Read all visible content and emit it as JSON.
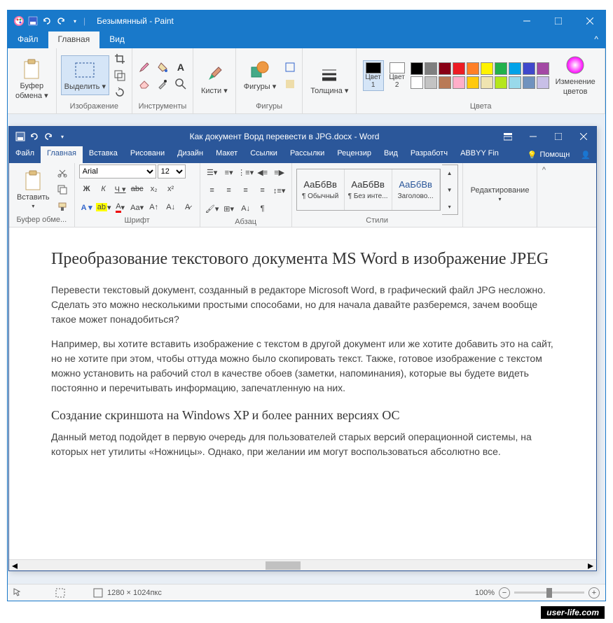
{
  "paint": {
    "title": "Безымянный - Paint",
    "tabs": {
      "file": "Файл",
      "home": "Главная",
      "view": "Вид"
    },
    "groups": {
      "clipboard": {
        "label": "Буфер\nобмена",
        "paste": "Буфер\nобмена ▾"
      },
      "image": {
        "label": "Изображение",
        "select": "Выделить ▾"
      },
      "tools": {
        "label": "Инструменты",
        "brushes": "Кисти ▾"
      },
      "shapes": {
        "label": "Фигуры",
        "btn": "Фигуры ▾"
      },
      "size": {
        "label": "",
        "btn": "Толщина ▾"
      },
      "colors": {
        "label": "Цвета",
        "c1": "Цвет\n1",
        "c2": "Цвет\n2",
        "edit": "Изменение\nцветов"
      }
    },
    "palette": [
      "#000000",
      "#7f7f7f",
      "#880015",
      "#ed1c24",
      "#ff7f27",
      "#fff200",
      "#22b14c",
      "#00a2e8",
      "#3f48cc",
      "#a349a4",
      "#ffffff",
      "#c3c3c3",
      "#b97a57",
      "#ffaec9",
      "#ffc90e",
      "#efe4b0",
      "#b5e61d",
      "#99d9ea",
      "#7092be",
      "#c8bfe7"
    ],
    "status": {
      "coords": "",
      "dims": "1280 × 1024пкс",
      "zoom": "100%"
    }
  },
  "word": {
    "title": "Как документ Ворд перевести в JPG.docx  -  Word",
    "tabs": [
      "Файл",
      "Главная",
      "Вставка",
      "Рисовани",
      "Дизайн",
      "Макет",
      "Ссылки",
      "Рассылки",
      "Рецензир",
      "Вид",
      "Разработч",
      "ABBYY Fin"
    ],
    "help": "Помощн",
    "ribbon": {
      "clipboard": {
        "paste": "Вставить",
        "label": "Буфер обме..."
      },
      "font": {
        "name": "Arial",
        "size": "12",
        "label": "Шрифт"
      },
      "para": {
        "label": "Абзац"
      },
      "styles": {
        "label": "Стили",
        "s1": "¶ Обычный",
        "s2": "¶ Без инте...",
        "s3": "Заголово...",
        "preview": "АаБбВв"
      },
      "editing": {
        "label": "Редактирование"
      }
    },
    "doc": {
      "h1": "Преобразование текстового документа MS Word в изображение JPEG",
      "p1": "Перевести текстовый документ, созданный в редакторе Microsoft Word, в графический файл JPG несложно. Сделать это можно несколькими простыми способами, но для начала давайте разберемся, зачем вообще такое может понадобиться?",
      "p2": "Например, вы хотите вставить изображение с текстом в другой документ или же хотите добавить это на сайт, но не хотите при этом, чтобы оттуда можно было скопировать текст. Также, готовое изображение с текстом можно установить на рабочий стол в качестве обоев (заметки, напоминания), которые вы будете видеть постоянно и перечитывать информацию, запечатленную на них.",
      "h2": "Создание скриншота на Windows XP и более ранних версиях ОС",
      "p3": "Данный метод подойдет в первую очередь для пользователей старых версий операционной системы, на которых нет утилиты «Ножницы». Однако, при желании им могут воспользоваться абсолютно все."
    }
  },
  "watermark": "user-life.com"
}
